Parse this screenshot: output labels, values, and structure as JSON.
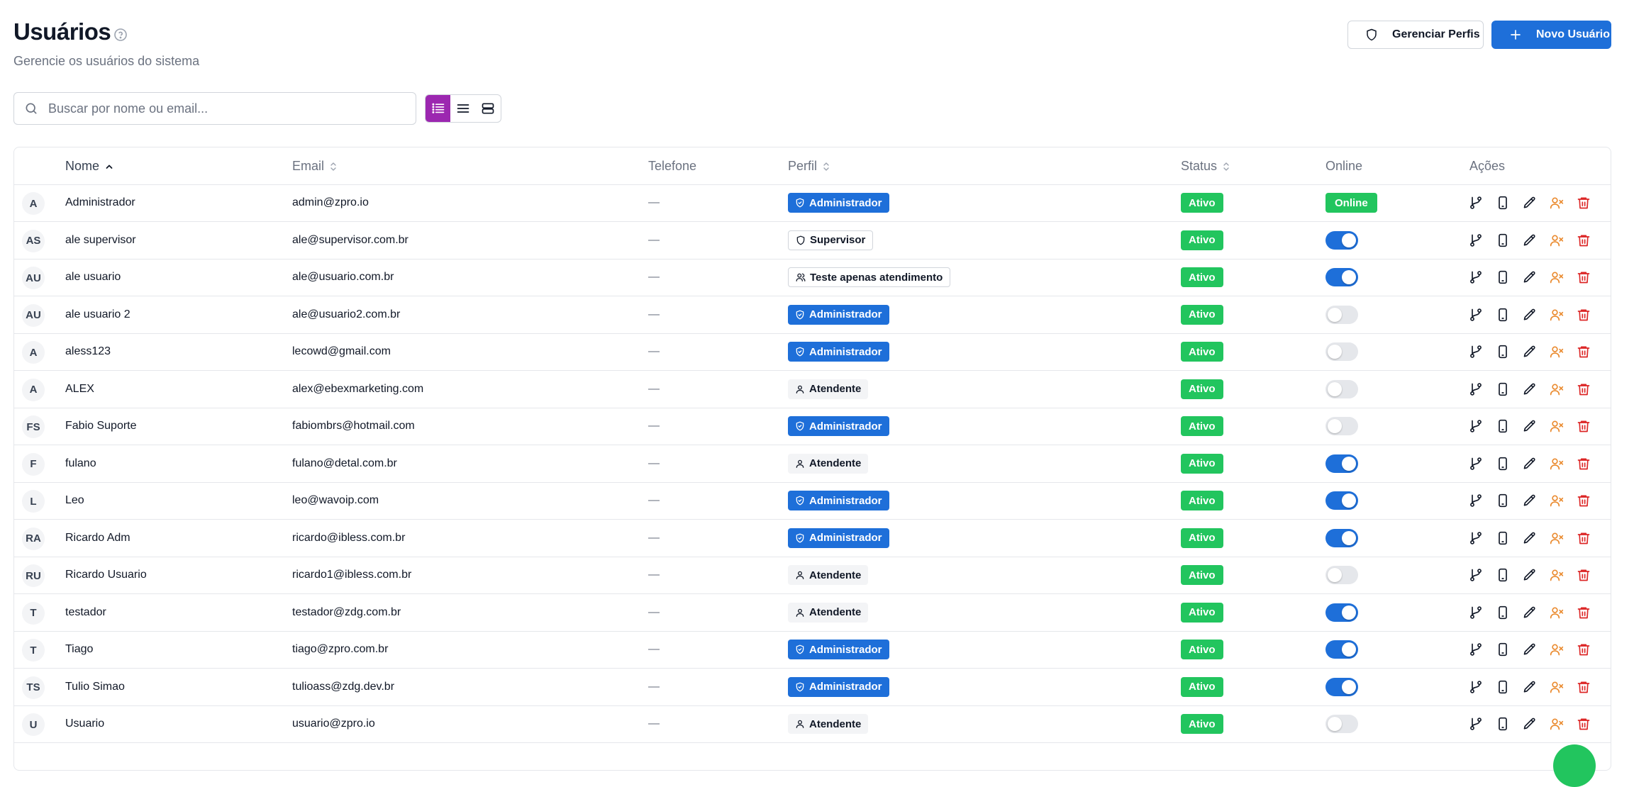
{
  "header": {
    "title": "Usuários",
    "subtitle": "Gerencie os usuários do sistema",
    "manage_profiles_label": "Gerenciar Perfis",
    "new_user_label": "Novo Usuário"
  },
  "search": {
    "placeholder": "Buscar por nome ou email...",
    "value": ""
  },
  "view_modes": {
    "active": "list-detailed",
    "options": [
      "list-detailed",
      "list-compact",
      "cards"
    ]
  },
  "table": {
    "columns": {
      "name": "Nome",
      "email": "Email",
      "phone": "Telefone",
      "profile": "Perfil",
      "status": "Status",
      "online": "Online",
      "actions": "Ações"
    },
    "sort": {
      "column": "name",
      "direction": "asc"
    },
    "rows": [
      {
        "initials": "A",
        "name": "Administrador",
        "email": "admin@zpro.io",
        "phone": "—",
        "profile": "Administrador",
        "profile_type": "admin",
        "status": "Ativo",
        "online": "badge",
        "online_label": "Online"
      },
      {
        "initials": "AS",
        "name": "ale supervisor",
        "email": "ale@supervisor.com.br",
        "phone": "—",
        "profile": "Supervisor",
        "profile_type": "supervisor",
        "status": "Ativo",
        "online": "on"
      },
      {
        "initials": "AU",
        "name": "ale usuario",
        "email": "ale@usuario.com.br",
        "phone": "—",
        "profile": "Teste apenas atendimento",
        "profile_type": "custom",
        "status": "Ativo",
        "online": "on"
      },
      {
        "initials": "AU",
        "name": "ale usuario 2",
        "email": "ale@usuario2.com.br",
        "phone": "—",
        "profile": "Administrador",
        "profile_type": "admin",
        "status": "Ativo",
        "online": "off"
      },
      {
        "initials": "A",
        "name": "aless123",
        "email": "lecowd@gmail.com",
        "phone": "—",
        "profile": "Administrador",
        "profile_type": "admin",
        "status": "Ativo",
        "online": "off"
      },
      {
        "initials": "A",
        "name": "ALEX",
        "email": "alex@ebexmarketing.com",
        "phone": "—",
        "profile": "Atendente",
        "profile_type": "attendant",
        "status": "Ativo",
        "online": "off"
      },
      {
        "initials": "FS",
        "name": "Fabio Suporte",
        "email": "fabiombrs@hotmail.com",
        "phone": "—",
        "profile": "Administrador",
        "profile_type": "admin",
        "status": "Ativo",
        "online": "off"
      },
      {
        "initials": "F",
        "name": "fulano",
        "email": "fulano@detal.com.br",
        "phone": "—",
        "profile": "Atendente",
        "profile_type": "attendant",
        "status": "Ativo",
        "online": "on"
      },
      {
        "initials": "L",
        "name": "Leo",
        "email": "leo@wavoip.com",
        "phone": "—",
        "profile": "Administrador",
        "profile_type": "admin",
        "status": "Ativo",
        "online": "on"
      },
      {
        "initials": "RA",
        "name": "Ricardo Adm",
        "email": "ricardo@ibless.com.br",
        "phone": "—",
        "profile": "Administrador",
        "profile_type": "admin",
        "status": "Ativo",
        "online": "on"
      },
      {
        "initials": "RU",
        "name": "Ricardo Usuario",
        "email": "ricardo1@ibless.com.br",
        "phone": "—",
        "profile": "Atendente",
        "profile_type": "attendant",
        "status": "Ativo",
        "online": "off"
      },
      {
        "initials": "T",
        "name": "testador",
        "email": "testador@zdg.com.br",
        "phone": "—",
        "profile": "Atendente",
        "profile_type": "attendant",
        "status": "Ativo",
        "online": "on"
      },
      {
        "initials": "T",
        "name": "Tiago",
        "email": "tiago@zpro.com.br",
        "phone": "—",
        "profile": "Administrador",
        "profile_type": "admin",
        "status": "Ativo",
        "online": "on"
      },
      {
        "initials": "TS",
        "name": "Tulio Simao",
        "email": "tulioass@zdg.dev.br",
        "phone": "—",
        "profile": "Administrador",
        "profile_type": "admin",
        "status": "Ativo",
        "online": "on"
      },
      {
        "initials": "U",
        "name": "Usuario",
        "email": "usuario@zpro.io",
        "phone": "—",
        "profile": "Atendente",
        "profile_type": "attendant",
        "status": "Ativo",
        "online": "off"
      }
    ]
  },
  "colors": {
    "primary": "#1e6fd9",
    "success": "#22c55e",
    "active_view": "#9c27b0",
    "warning_icon": "#ea8a2e",
    "danger_icon": "#dc2626"
  }
}
